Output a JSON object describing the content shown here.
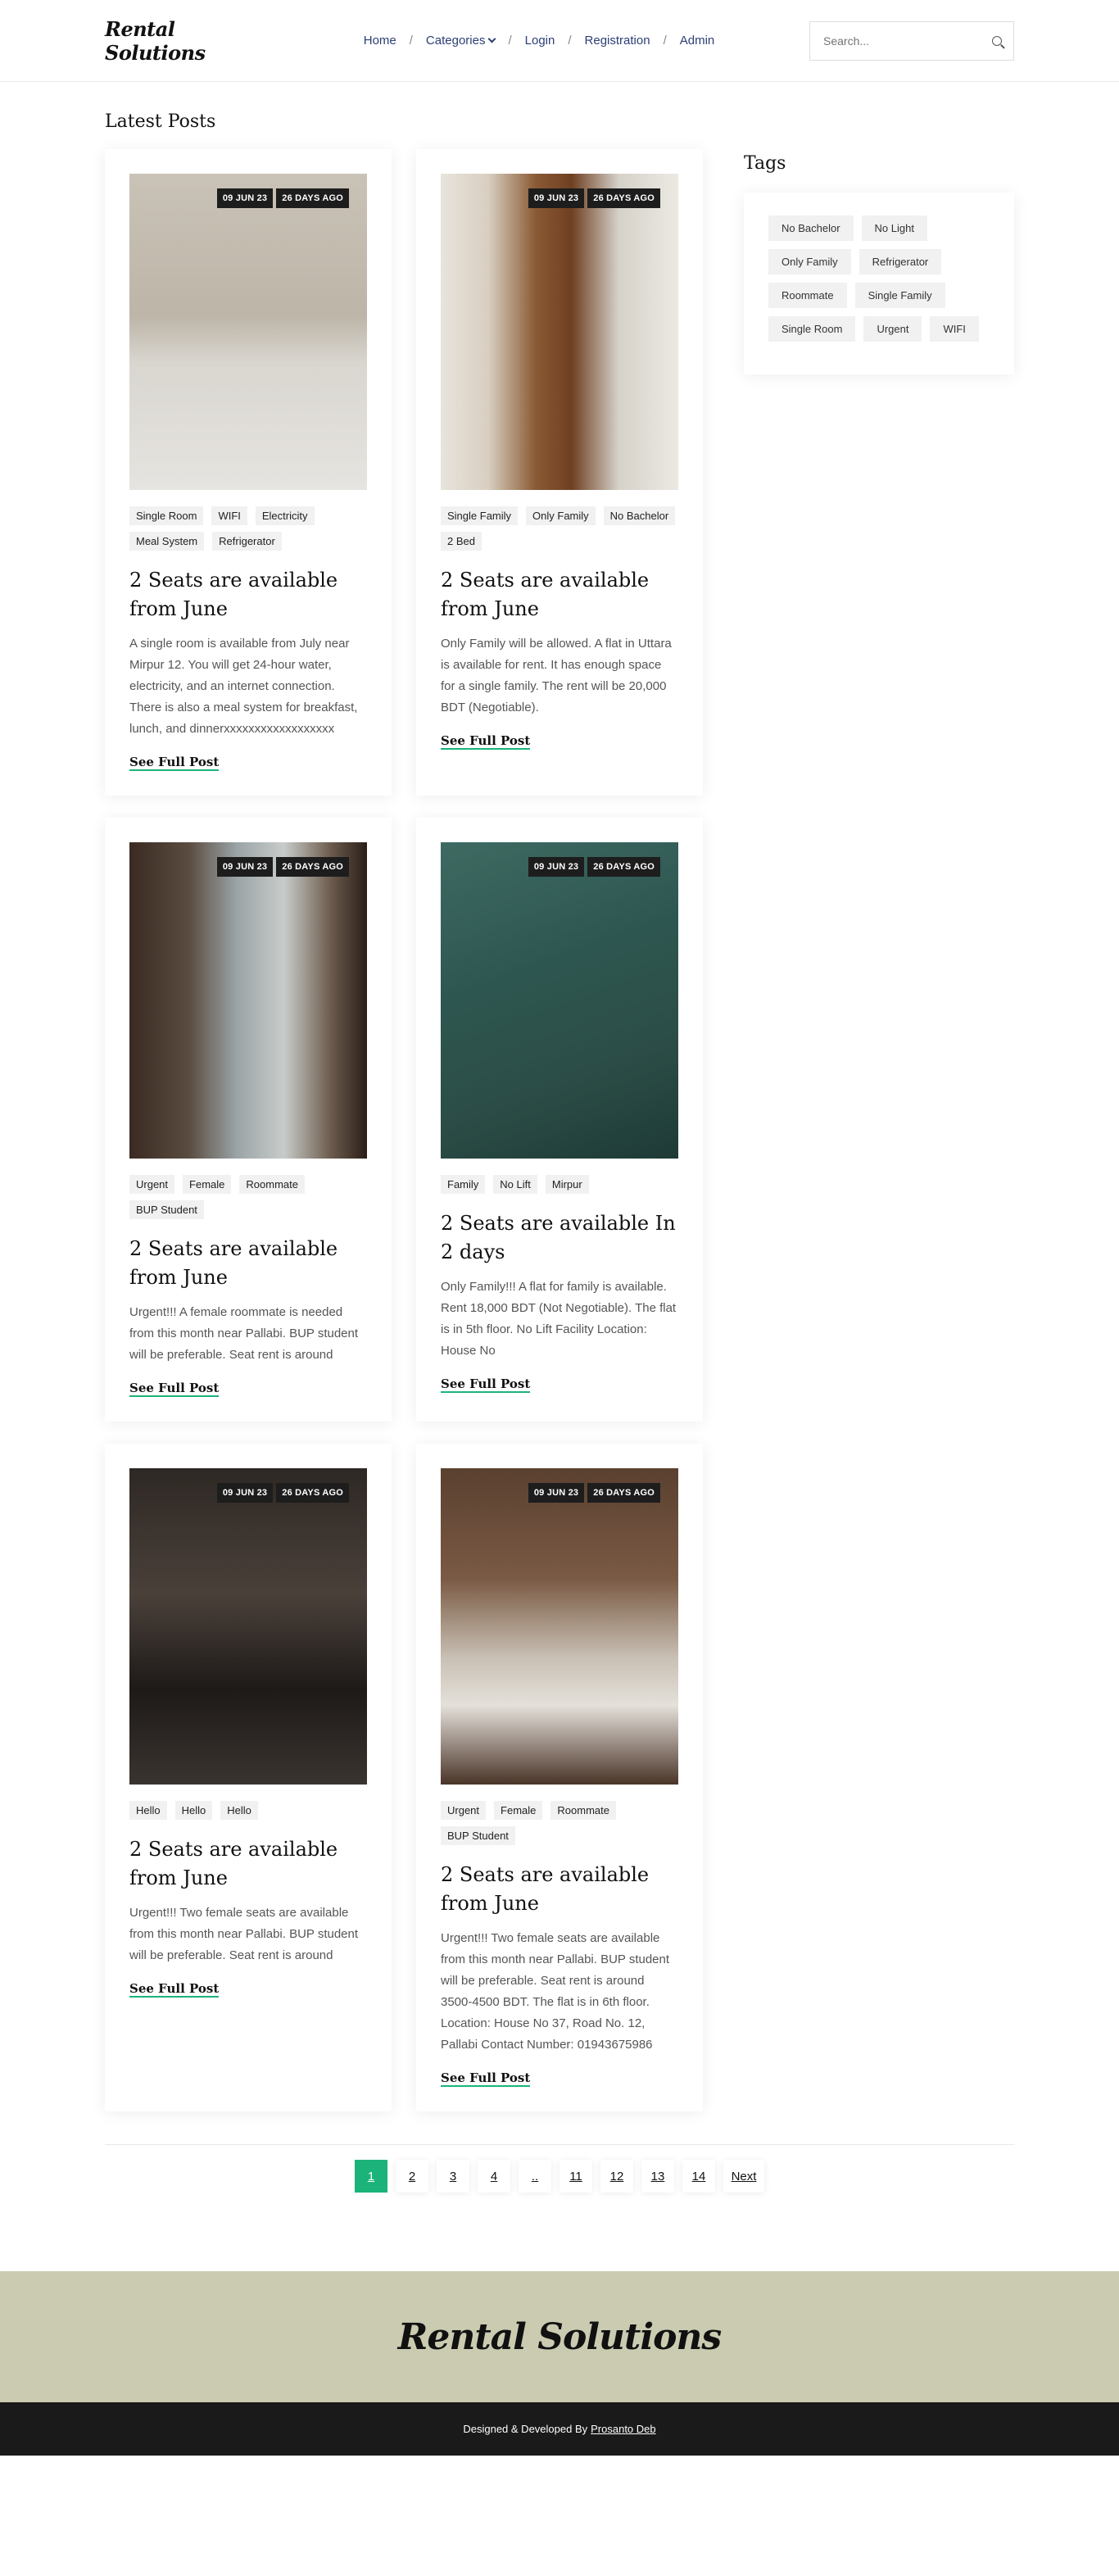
{
  "header": {
    "logo": "Rental Solutions",
    "nav": [
      "Home",
      "Categories",
      "Login",
      "Registration",
      "Admin"
    ],
    "search_placeholder": "Search..."
  },
  "main": {
    "title": "Latest Posts",
    "see_more": "See Full Post",
    "posts": [
      {
        "date": "09 JUN 23",
        "ago": "26 DAYS AGO",
        "tags": [
          "Single Room",
          "WIFI",
          "Electricity",
          "Meal System",
          "Refrigerator"
        ],
        "title": "2 Seats are available from June",
        "excerpt": "A single room is available from July near Mirpur 12. You will get 24-hour water, electricity, and an internet connection. There is also a meal system for breakfast, lunch, and dinnerxxxxxxxxxxxxxxxxxx"
      },
      {
        "date": "09 JUN 23",
        "ago": "26 DAYS AGO",
        "tags": [
          "Single Family",
          "Only Family",
          "No Bachelor",
          "2 Bed"
        ],
        "title": "2 Seats are available from June",
        "excerpt": "Only Family will be allowed. A flat in Uttara is available for rent. It has enough space for a single family. The rent will be 20,000 BDT (Negotiable)."
      },
      {
        "date": "09 JUN 23",
        "ago": "26 DAYS AGO",
        "tags": [
          "Urgent",
          "Female",
          "Roommate",
          "BUP Student"
        ],
        "title": "2 Seats are available from June",
        "excerpt": "Urgent!!! A female roommate is needed from this month near Pallabi. BUP student will be preferable. Seat rent is around"
      },
      {
        "date": "09 JUN 23",
        "ago": "26 DAYS AGO",
        "tags": [
          "Family",
          "No Lift",
          "Mirpur"
        ],
        "title": "2 Seats are available In 2 days",
        "excerpt": "Only Family!!! A flat for family is available. Rent 18,000 BDT (Not Negotiable). The flat is in 5th floor. No Lift Facility Location: House No"
      },
      {
        "date": "09 JUN 23",
        "ago": "26 DAYS AGO",
        "tags": [
          "Hello",
          "Hello",
          "Hello"
        ],
        "title": "2 Seats are available from June",
        "excerpt": "Urgent!!! Two female seats are available from this month near Pallabi. BUP student will be preferable. Seat rent is around"
      },
      {
        "date": "09 JUN 23",
        "ago": "26 DAYS AGO",
        "tags": [
          "Urgent",
          "Female",
          "Roommate",
          "BUP Student"
        ],
        "title": "2 Seats are available from June",
        "excerpt": "Urgent!!! Two female seats are available from this month near Pallabi. BUP student will be preferable. Seat rent is around 3500-4500 BDT. The flat is in 6th floor. Location: House No 37, Road No. 12, Pallabi Contact Number: 01943675986"
      }
    ]
  },
  "sidebar": {
    "title": "Tags",
    "tags": [
      "No Bachelor",
      "No Light",
      "Only Family",
      "Refrigerator",
      "Roommate",
      "Single Family",
      "Single Room",
      "Urgent",
      "WIFI"
    ]
  },
  "pagination": {
    "pages": [
      "1",
      "2",
      "3",
      "4",
      "..",
      "11",
      "12",
      "13",
      "14"
    ],
    "next": "Next",
    "active": "1"
  },
  "footer": {
    "logo": "Rental Solutions",
    "credit": "Designed & Developed By",
    "author": "Prosanto Deb"
  },
  "icons": [
    "search-icon",
    "chevron-down-icon"
  ],
  "colors": {
    "accent": "#1bb37a",
    "nav": "#2c3e75",
    "footer_top": "#cbcbb1",
    "footer_bottom": "#1a1a1a"
  }
}
